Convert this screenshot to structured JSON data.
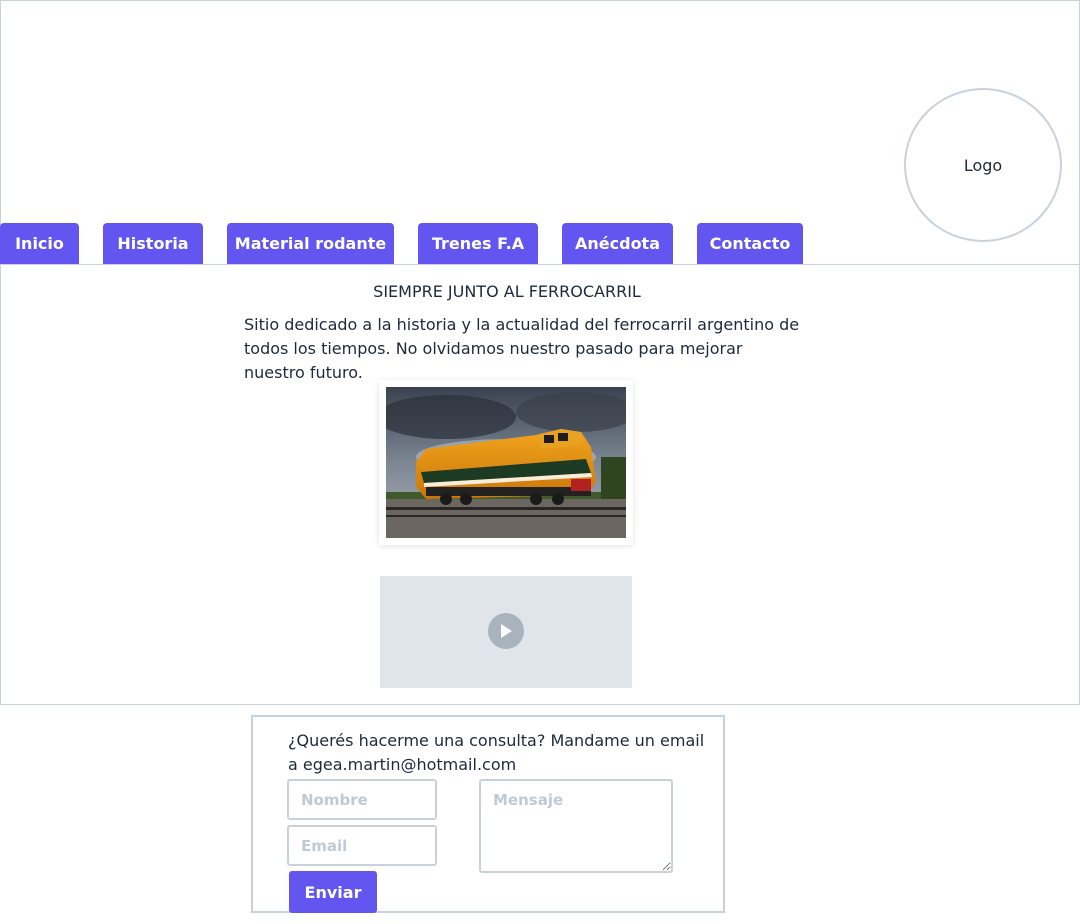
{
  "header": {
    "logo_label": "Logo",
    "nav": [
      {
        "label": "Inicio"
      },
      {
        "label": "Historia"
      },
      {
        "label": "Material rodante"
      },
      {
        "label": "Trenes F.A"
      },
      {
        "label": "Anécdota"
      },
      {
        "label": "Contacto"
      }
    ]
  },
  "main": {
    "title": "SIEMPRE JUNTO AL FERROCARRIL",
    "text": "Sitio dedicado a la historia y la actualidad del ferrocarril argentino de todos los tiempos. No olvidamos nuestro pasado para mejorar nuestro futuro.",
    "video_icon": "play-icon"
  },
  "contact": {
    "text": "¿Querés hacerme una consulta? Mandame un email a egea.martin@hotmail.com",
    "name_placeholder": "Nombre",
    "email_placeholder": "Email",
    "message_placeholder": "Mensaje",
    "send_label": "Enviar"
  },
  "colors": {
    "accent": "#6356f0",
    "border": "#c8d2dc"
  }
}
